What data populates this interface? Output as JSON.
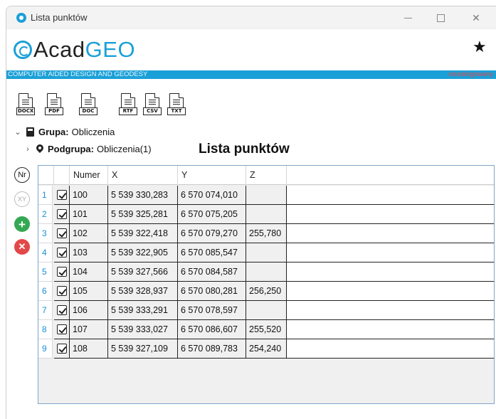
{
  "window": {
    "title": "Lista punktów"
  },
  "logo": {
    "part1": "AcadGEO_1",
    "acad": "Acad",
    "geo": "GEO"
  },
  "banner": {
    "text": "COMPUTER AIDED DESIGN AND GEODESY",
    "status": "niezalogowany",
    "color": "#1aa0d8",
    "status_color": "#e04848"
  },
  "toolbar": {
    "buttons": [
      {
        "label": "DOCX",
        "icon": "docx-file-icon"
      },
      {
        "label": "PDF",
        "icon": "pdf-file-icon"
      },
      {
        "label": "DOC",
        "icon": "doc-file-icon"
      },
      {
        "label": "RTF",
        "icon": "rtf-file-icon"
      },
      {
        "label": "CSV",
        "icon": "csv-file-icon"
      },
      {
        "label": "TXT",
        "icon": "txt-file-icon"
      }
    ]
  },
  "tree": {
    "group_label": "Grupa:",
    "group_value": "Obliczenia",
    "subgroup_label": "Podgrupa:",
    "subgroup_value": "Obliczenia(1)"
  },
  "list_title": "Lista punktów",
  "side_buttons": {
    "nr": "Nr",
    "xy": "XY",
    "add": "+",
    "delete": "✕"
  },
  "grid": {
    "columns": [
      "Numer",
      "X",
      "Y",
      "Z"
    ],
    "rows": [
      {
        "idx": "1",
        "checked": true,
        "num": "100",
        "x": "5 539 330,283",
        "y": "6 570 074,010",
        "z": ""
      },
      {
        "idx": "2",
        "checked": true,
        "num": "101",
        "x": "5 539 325,281",
        "y": "6 570 075,205",
        "z": ""
      },
      {
        "idx": "3",
        "checked": true,
        "num": "102",
        "x": "5 539 322,418",
        "y": "6 570 079,270",
        "z": "255,780"
      },
      {
        "idx": "4",
        "checked": true,
        "num": "103",
        "x": "5 539 322,905",
        "y": "6 570 085,547",
        "z": ""
      },
      {
        "idx": "5",
        "checked": true,
        "num": "104",
        "x": "5 539 327,566",
        "y": "6 570 084,587",
        "z": ""
      },
      {
        "idx": "6",
        "checked": true,
        "num": "105",
        "x": "5 539 328,937",
        "y": "6 570 080,281",
        "z": "256,250"
      },
      {
        "idx": "7",
        "checked": true,
        "num": "106",
        "x": "5 539 333,291",
        "y": "6 570 078,597",
        "z": ""
      },
      {
        "idx": "8",
        "checked": true,
        "num": "107",
        "x": "5 539 333,027",
        "y": "6 570 086,607",
        "z": "255,520"
      },
      {
        "idx": "9",
        "checked": true,
        "num": "108",
        "x": "5 539 327,109",
        "y": "6 570 089,783",
        "z": "254,240"
      }
    ]
  }
}
